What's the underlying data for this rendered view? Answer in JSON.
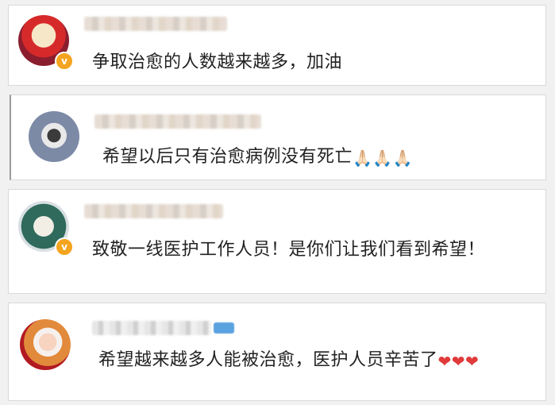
{
  "comments": [
    {
      "text": "争取治愈的人数越来越多，加油",
      "verified": true,
      "badge_glyph": "v",
      "avatar_icon": "avatar-mask-icon"
    },
    {
      "text": "希望以后只有治愈病例没有死亡",
      "emoji": "🙏🏻🙏🏻🙏🏻",
      "verified": false,
      "avatar_icon": "avatar-person-icon"
    },
    {
      "text": "致敬一线医护工作人员！是你们让我们看到希望！",
      "verified": true,
      "badge_glyph": "v",
      "avatar_icon": "avatar-bodhisattva-icon"
    },
    {
      "text": "希望越来越多人能被治愈，医护人员辛苦了",
      "emoji": "❤❤❤",
      "verified": false,
      "avatar_icon": "avatar-girl-icon"
    }
  ],
  "colors": {
    "page_bg": "#f1f1f1",
    "card_bg": "#ffffff",
    "text": "#222222",
    "badge": "#f4a41f",
    "heart": "#e03a3a"
  }
}
